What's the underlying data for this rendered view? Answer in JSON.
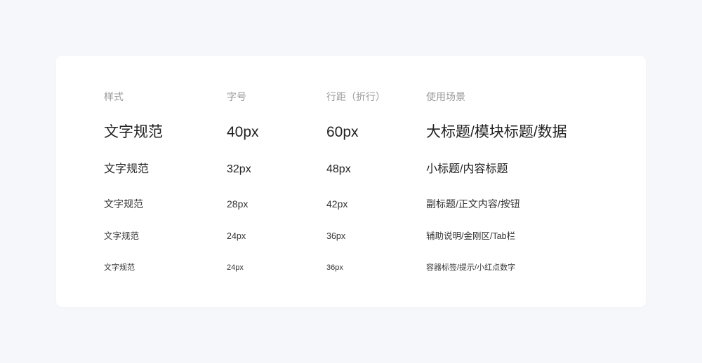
{
  "table": {
    "headers": [
      "样式",
      "字号",
      "行距（折行）",
      "使用场景"
    ],
    "rows": [
      {
        "style": "文字规范",
        "size": "40px",
        "line_height": "60px",
        "usage": "大标题/模块标题/数据"
      },
      {
        "style": "文字规范",
        "size": "32px",
        "line_height": "48px",
        "usage": "小标题/内容标题"
      },
      {
        "style": "文字规范",
        "size": "28px",
        "line_height": "42px",
        "usage": "副标题/正文内容/按钮"
      },
      {
        "style": "文字规范",
        "size": "24px",
        "line_height": "36px",
        "usage": "辅助说明/金刚区/Tab栏"
      },
      {
        "style": "文字规范",
        "size": "24px",
        "line_height": "36px",
        "usage": "容器标签/提示/小红点数字"
      }
    ]
  },
  "colors": {
    "page_background": "#f6f7fb",
    "card_background": "#ffffff",
    "header_text": "#9a9a9a",
    "body_text": "#2b2b2b"
  }
}
